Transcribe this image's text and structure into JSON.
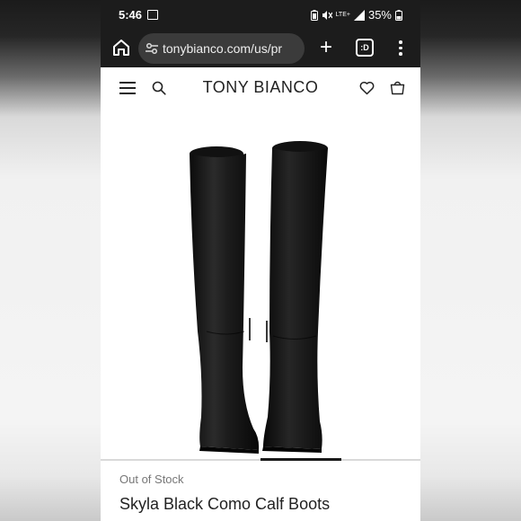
{
  "status_bar": {
    "time": "5:46",
    "network": "LTE+",
    "battery": "35%"
  },
  "browser": {
    "url": "tonybianco.com/us/pr",
    "tab_label": ":D"
  },
  "site": {
    "brand": "TONY BIANCO"
  },
  "product": {
    "stock_status": "Out of Stock",
    "name": "Skyla Black Como Calf Boots"
  },
  "icons": [
    "home-icon",
    "site-settings-icon",
    "plus-icon",
    "tab-switcher-icon",
    "more-menu-icon",
    "hamburger-icon",
    "search-icon",
    "wishlist-icon",
    "cart-icon"
  ],
  "colors": {
    "browser_chrome": "#1c1c1c",
    "url_pill": "#3b3b3b",
    "text_dark": "#222222",
    "text_muted": "#777777",
    "boot_black": "#141414"
  }
}
